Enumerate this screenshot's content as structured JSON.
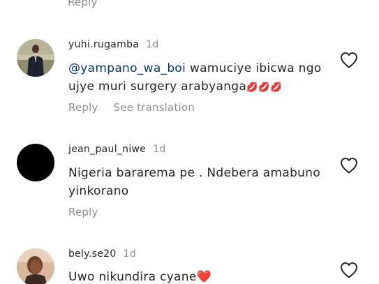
{
  "previous": {
    "reply_label": "Reply"
  },
  "comments": [
    {
      "username": "yuhi.rugamba",
      "time": "1d",
      "mention": "@yampano_wa_boi",
      "text": " wamuciye ibicwa ngo ujye muri surgery arabyanga",
      "emoji": "💋💋💋",
      "reply_label": "Reply",
      "translate_label": "See translation",
      "avatar_icon": "profile-photo-man-in-suit"
    },
    {
      "username": "jean_paul_niwe",
      "time": "1d",
      "text": "Nigeria bararema pe . Ndebera amabuno yinkorano",
      "reply_label": "Reply",
      "avatar_icon": "black-circle-avatar"
    },
    {
      "username": "bely.se20",
      "time": "1d",
      "text": "Uwo nikundira cyane",
      "emoji": "❤️",
      "avatar_icon": "profile-photo-woman"
    }
  ],
  "colors": {
    "text": "#262626",
    "secondary": "#8e8e8e",
    "mention": "#00376b",
    "heart_red": "#e0191c",
    "kiss_pink": "#e55ac9"
  }
}
